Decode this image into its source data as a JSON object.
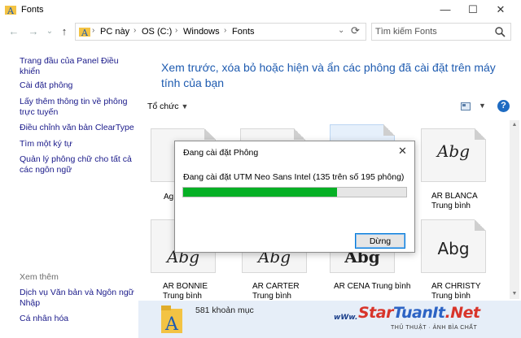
{
  "window": {
    "title": "Fonts"
  },
  "controls": {
    "minimize": "—",
    "maximize": "☐",
    "close": "✕"
  },
  "nav": {
    "back": "←",
    "forward": "→",
    "up": "↑"
  },
  "address": {
    "crumbs": [
      "PC này",
      "OS (C:)",
      "Windows",
      "Fonts"
    ],
    "separator": "›",
    "dropdown": "⌄",
    "refresh": "⟳"
  },
  "search": {
    "placeholder": "Tìm kiếm Fonts"
  },
  "sidebar": {
    "links": [
      "Trang đầu của Panel Điều khiển",
      "Cài đặt phông",
      "Lấy thêm thông tin về phông trực tuyến",
      "Điều chỉnh văn bản ClearType",
      "Tìm một ký tự",
      "Quản lý phông chữ cho tất cả các ngôn ngữ"
    ],
    "see_also_header": "Xem thêm",
    "see_also": [
      "Dịch vụ Văn bản và Ngôn ngữ Nhập",
      "Cá nhân hóa"
    ]
  },
  "main": {
    "heading": "Xem trước, xóa bỏ hoặc hiện và ẩn các phông đã cài đặt trên máy tính của bạn",
    "organize": "Tổ chức",
    "help": "?"
  },
  "fonts": [
    {
      "name": "Ag",
      "style": "",
      "sample": ""
    },
    {
      "name": "",
      "style": "",
      "sample": ""
    },
    {
      "name": "",
      "style": "",
      "sample": ""
    },
    {
      "name": "AR BLANCA",
      "style": "Trung bình",
      "sample": "Abg"
    },
    {
      "name": "AR BONNIE",
      "style": "Trung bình",
      "sample": "Abg"
    },
    {
      "name": "AR CARTER",
      "style": "Trung bình",
      "sample": "Abg"
    },
    {
      "name": "AR CENA Trung bình",
      "style": "",
      "sample": "Abg"
    },
    {
      "name": "AR CHRISTY",
      "style": "Trung bình",
      "sample": "Abg"
    }
  ],
  "status": {
    "text": "581 khoản mục"
  },
  "watermark": {
    "prefix": "wWw.",
    "brand_a": "Star",
    "brand_b": "TuanIt",
    "brand_c": ".Net",
    "tagline": "THỦ THUẬT · ẢNH BÌA CHẤT"
  },
  "dialog": {
    "title": "Đang cài đặt Phông",
    "message": "Đang cài đặt UTM Neo Sans Intel (135 trên số 195 phông)",
    "progress": 0.69,
    "stop_button": "Dừng",
    "close": "✕"
  },
  "colors": {
    "link": "#1a1a8a",
    "heading": "#1e5bb0",
    "progress": "#06b025",
    "status_bg": "#e6eef8"
  }
}
